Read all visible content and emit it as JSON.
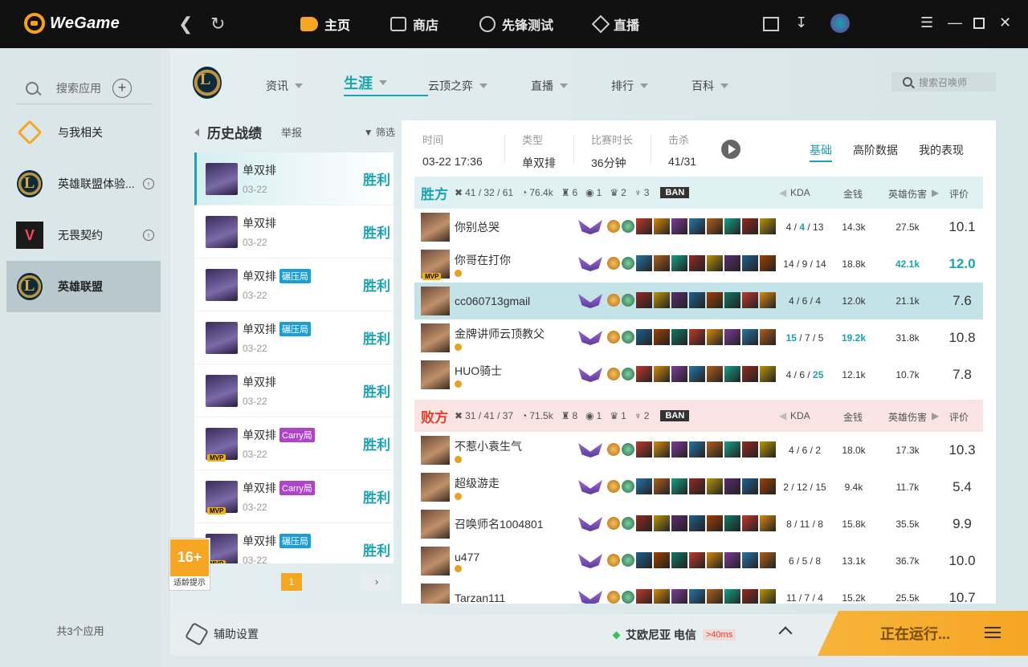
{
  "app": {
    "title": "WeGame"
  },
  "topnav": {
    "items": [
      {
        "label": "主页",
        "icon": "home-icon"
      },
      {
        "label": "商店",
        "icon": "shop-icon"
      },
      {
        "label": "先锋测试",
        "icon": "test-icon"
      },
      {
        "label": "直播",
        "icon": "live-icon"
      }
    ]
  },
  "sidebar": {
    "search_placeholder": "搜索应用",
    "items": [
      {
        "label": "与我相关"
      },
      {
        "label": "英雄联盟体验..."
      },
      {
        "label": "无畏契约"
      },
      {
        "label": "英雄联盟"
      }
    ],
    "footer": "共3个应用"
  },
  "lol_tabs": [
    {
      "label": "资讯"
    },
    {
      "label": "生涯"
    },
    {
      "label": "云顶之弈"
    },
    {
      "label": "直播"
    },
    {
      "label": "排行"
    },
    {
      "label": "百科"
    }
  ],
  "summoner_search_placeholder": "搜索召唤师",
  "history": {
    "title": "历史战绩",
    "report": "举报",
    "filter": "筛选",
    "page": "1",
    "rows": [
      {
        "queue": "单双排",
        "date": "03-22",
        "result": "胜利",
        "tag": "",
        "mvp": false
      },
      {
        "queue": "单双排",
        "date": "03-22",
        "result": "胜利",
        "tag": "",
        "mvp": false
      },
      {
        "queue": "单双排",
        "date": "03-22",
        "result": "胜利",
        "tag": "碾压局",
        "mvp": false
      },
      {
        "queue": "单双排",
        "date": "03-22",
        "result": "胜利",
        "tag": "碾压局",
        "mvp": false
      },
      {
        "queue": "单双排",
        "date": "03-22",
        "result": "胜利",
        "tag": "",
        "mvp": false
      },
      {
        "queue": "单双排",
        "date": "03-22",
        "result": "胜利",
        "tag": "Carry局",
        "mvp": true
      },
      {
        "queue": "单双排",
        "date": "03-22",
        "result": "胜利",
        "tag": "Carry局",
        "mvp": true
      },
      {
        "queue": "单双排",
        "date": "03-22",
        "result": "胜利",
        "tag": "碾压局",
        "mvp": true
      }
    ]
  },
  "age_rating": {
    "badge": "16+",
    "sub": "适龄提示"
  },
  "match": {
    "labels": {
      "time": "时间",
      "type": "类型",
      "duration": "比赛时长",
      "kills": "击杀"
    },
    "time": "03-22 17:36",
    "type": "单双排",
    "duration": "36分钟",
    "kills": "41/31",
    "tabs": [
      "基础",
      "高阶数据",
      "我的表现"
    ],
    "columns": {
      "kda": "KDA",
      "gold": "金钱",
      "damage": "英雄伤害",
      "score": "评价"
    },
    "ban_label": "BAN",
    "win": {
      "name": "胜方",
      "kda": "41 / 32 / 61",
      "gold": "76.4k",
      "towers": "6",
      "inhib": "1",
      "baron": "2",
      "dragon": "3",
      "players": [
        {
          "name": "你别总哭",
          "k": "4",
          "d": "4",
          "a": "13",
          "gold": "14.3k",
          "dmg": "27.5k",
          "score": "10.1",
          "mvp": false,
          "me": false
        },
        {
          "name": "你哥在打你",
          "k": "14",
          "d": "9",
          "a": "14",
          "gold": "18.8k",
          "dmg": "42.1k",
          "score": "12.0",
          "mvp": true,
          "me": false
        },
        {
          "name": "cc060713gmail",
          "k": "4",
          "d": "6",
          "a": "4",
          "gold": "12.0k",
          "dmg": "21.1k",
          "score": "7.6",
          "mvp": false,
          "me": true
        },
        {
          "name": "金牌讲师云顶教父",
          "k": "15",
          "d": "7",
          "a": "5",
          "gold": "19.2k",
          "dmg": "31.8k",
          "score": "10.8",
          "mvp": false,
          "me": false
        },
        {
          "name": "HUO骑士",
          "k": "4",
          "d": "6",
          "a": "25",
          "gold": "12.1k",
          "dmg": "10.7k",
          "score": "7.8",
          "mvp": false,
          "me": false
        }
      ]
    },
    "lose": {
      "name": "败方",
      "kda": "31 / 41 / 37",
      "gold": "71.5k",
      "towers": "8",
      "inhib": "1",
      "baron": "1",
      "dragon": "2",
      "players": [
        {
          "name": "不惹小袁生气",
          "k": "4",
          "d": "6",
          "a": "2",
          "gold": "18.0k",
          "dmg": "17.3k",
          "score": "10.3"
        },
        {
          "name": "超级游走",
          "k": "2",
          "d": "12",
          "a": "15",
          "gold": "9.4k",
          "dmg": "11.7k",
          "score": "5.4"
        },
        {
          "name": "召唤师名1004801",
          "k": "8",
          "d": "11",
          "a": "8",
          "gold": "15.8k",
          "dmg": "35.5k",
          "score": "9.9"
        },
        {
          "name": "u477",
          "k": "6",
          "d": "5",
          "a": "8",
          "gold": "13.1k",
          "dmg": "36.7k",
          "score": "10.0"
        },
        {
          "name": "Tarzan111",
          "k": "11",
          "d": "7",
          "a": "4",
          "gold": "15.2k",
          "dmg": "25.5k",
          "score": "10.7"
        }
      ]
    }
  },
  "bottom": {
    "assist": "辅助设置",
    "server": "艾欧尼亚 电信",
    "ping": ">40ms",
    "running": "正在运行..."
  },
  "colors": {
    "accent": "#1aa3b0",
    "orange": "#f5a623",
    "lose": "#e2412d"
  }
}
